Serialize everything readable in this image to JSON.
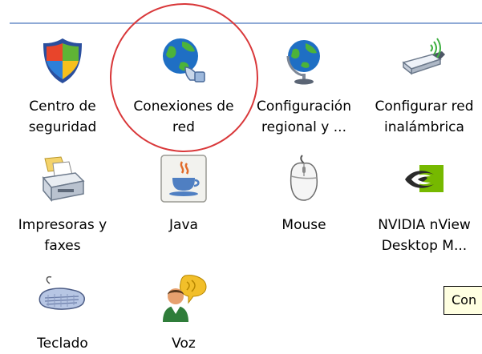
{
  "items": [
    {
      "label": "Centro de\nseguridad",
      "icon": "shield-icon"
    },
    {
      "label": "Conexiones de\nred",
      "icon": "network-globe-icon"
    },
    {
      "label": "Configuración\nregional y ...",
      "icon": "globe-stand-icon"
    },
    {
      "label": "Configurar red\ninalámbrica",
      "icon": "wireless-adapter-icon"
    },
    {
      "label": "Impresoras y\nfaxes",
      "icon": "printer-icon"
    },
    {
      "label": "Java",
      "icon": "java-icon"
    },
    {
      "label": "Mouse",
      "icon": "mouse-icon"
    },
    {
      "label": "NVIDIA nView\nDesktop M...",
      "icon": "nvidia-icon"
    },
    {
      "label": "Teclado",
      "icon": "keyboard-icon"
    },
    {
      "label": "Voz",
      "icon": "speech-icon"
    }
  ],
  "tooltip": {
    "text": "Con"
  },
  "colors": {
    "highlight": "#d9383a",
    "tooltip_bg": "#ffffe1",
    "rule": "#8faad6"
  }
}
